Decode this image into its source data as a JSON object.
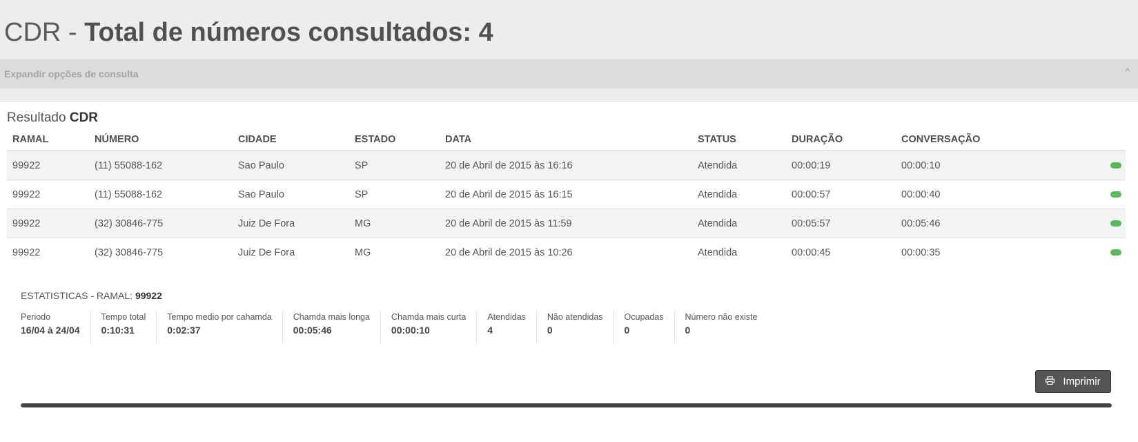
{
  "header": {
    "title_prefix": "CDR",
    "title_separator": "-",
    "title_main": "Total de números consultados: 4"
  },
  "filters": {
    "expand_label": "Expandir opções de consulta",
    "chevron": "^"
  },
  "result": {
    "heading_prefix": "Resultado",
    "heading_bold": "CDR",
    "columns": [
      "RAMAL",
      "NÚMERO",
      "CIDADE",
      "ESTADO",
      "DATA",
      "STATUS",
      "DURAÇÃO",
      "CONVERSAÇÃO"
    ],
    "rows": [
      {
        "ramal": "99922",
        "numero": "(11) 55088-162",
        "cidade": "Sao Paulo",
        "estado": "SP",
        "data": "20 de Abril de 2015 às 16:16",
        "status": "Atendida",
        "duracao": "00:00:19",
        "conversacao": "00:00:10"
      },
      {
        "ramal": "99922",
        "numero": "(11) 55088-162",
        "cidade": "Sao Paulo",
        "estado": "SP",
        "data": "20 de Abril de 2015 às 16:15",
        "status": "Atendida",
        "duracao": "00:00:57",
        "conversacao": "00:00:40"
      },
      {
        "ramal": "99922",
        "numero": "(32) 30846-775",
        "cidade": "Juiz De Fora",
        "estado": "MG",
        "data": "20 de Abril de 2015 às 11:59",
        "status": "Atendida",
        "duracao": "00:05:57",
        "conversacao": "00:05:46"
      },
      {
        "ramal": "99922",
        "numero": "(32) 30846-775",
        "cidade": "Juiz De Fora",
        "estado": "MG",
        "data": "20 de Abril de 2015 às 10:26",
        "status": "Atendida",
        "duracao": "00:00:45",
        "conversacao": "00:00:35"
      }
    ],
    "status_color": "#5cb85c"
  },
  "stats": {
    "title_prefix": "ESTATISTICAS - RAMAL:",
    "title_ramal": "99922",
    "items": [
      {
        "label": "Periodo",
        "value": "16/04 à 24/04"
      },
      {
        "label": "Tempo total",
        "value": "0:10:31"
      },
      {
        "label": "Tempo medio por cahamda",
        "value": "0:02:37"
      },
      {
        "label": "Chamda mais longa",
        "value": "00:05:46"
      },
      {
        "label": "Chamda mais curta",
        "value": "00:00:10"
      },
      {
        "label": "Atendidas",
        "value": "4"
      },
      {
        "label": "Não atendidas",
        "value": "0"
      },
      {
        "label": "Ocupadas",
        "value": "0"
      },
      {
        "label": "Número não existe",
        "value": "0"
      }
    ]
  },
  "actions": {
    "print_label": "Imprimir",
    "print_icon": "printer-icon"
  },
  "progress": {
    "percent": 100
  },
  "colors": {
    "accent_dark": "#555555",
    "status_green": "#5cb85c"
  }
}
